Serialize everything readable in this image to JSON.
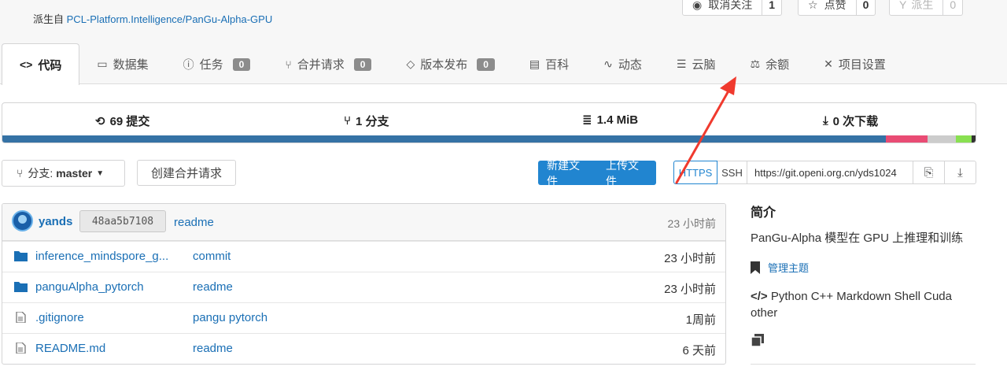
{
  "repo": {
    "fork_prefix": "派生自",
    "fork_source": "PCL-Platform.Intelligence/PanGu-Alpha-GPU"
  },
  "header_actions": {
    "watch": {
      "label": "取消关注",
      "count": "1"
    },
    "star": {
      "label": "点赞",
      "count": "0"
    },
    "fork": {
      "label": "派生",
      "count": "0"
    }
  },
  "tabs": [
    {
      "icon": "code-icon",
      "label": "代码",
      "badge": ""
    },
    {
      "icon": "database-icon",
      "label": "数据集",
      "badge": ""
    },
    {
      "icon": "issue-icon",
      "label": "任务",
      "badge": "0"
    },
    {
      "icon": "pull-request-icon",
      "label": "合并请求",
      "badge": "0"
    },
    {
      "icon": "tag-icon",
      "label": "版本发布",
      "badge": "0"
    },
    {
      "icon": "book-icon",
      "label": "百科",
      "badge": ""
    },
    {
      "icon": "pulse-icon",
      "label": "动态",
      "badge": ""
    },
    {
      "icon": "server-icon",
      "label": "云脑",
      "badge": ""
    },
    {
      "icon": "balance-icon",
      "label": "余额",
      "badge": ""
    },
    {
      "icon": "tools-icon",
      "label": "项目设置",
      "badge": ""
    }
  ],
  "stats": {
    "commits": "69 提交",
    "branches": "1 分支",
    "size": "1.4 MiB",
    "downloads": "0 次下载"
  },
  "language_bar": [
    {
      "color": "#3572A5",
      "share": 90.8
    },
    {
      "color": "#e94c74",
      "share": 4.3
    },
    {
      "color": "#cccccc",
      "share": 2.9
    },
    {
      "color": "#89e051",
      "share": 1.6
    },
    {
      "color": "#333333",
      "share": 0.4
    }
  ],
  "toolbar": {
    "branch_prefix": "分支:",
    "branch_name": "master",
    "new_pr": "创建合并请求",
    "new_file": "新建文件",
    "upload_file": "上传文件",
    "https": "HTTPS",
    "ssh": "SSH",
    "clone_url": "https://git.openi.org.cn/yds1024"
  },
  "latest_commit": {
    "author": "yands",
    "sha": "48aa5b7108",
    "message": "readme",
    "time": "23 小时前"
  },
  "files": [
    {
      "type": "folder",
      "name": "inference_mindspore_g...",
      "message": "commit",
      "time": "23 小时前"
    },
    {
      "type": "folder",
      "name": "panguAlpha_pytorch",
      "message": "readme",
      "time": "23 小时前"
    },
    {
      "type": "file",
      "name": ".gitignore",
      "message": "pangu pytorch",
      "time": "1周前"
    },
    {
      "type": "file",
      "name": "README.md",
      "message": "readme",
      "time": "6 天前"
    }
  ],
  "sidebar": {
    "title": "简介",
    "description": "PanGu-Alpha 模型在 GPU 上推理和训练",
    "topics_link": "管理主题",
    "languages": "Python C++ Markdown Shell Cuda other"
  },
  "colors": {
    "accent": "#2185d0",
    "link": "#1a6fb5",
    "annotation_arrow": "#f03a2e"
  }
}
